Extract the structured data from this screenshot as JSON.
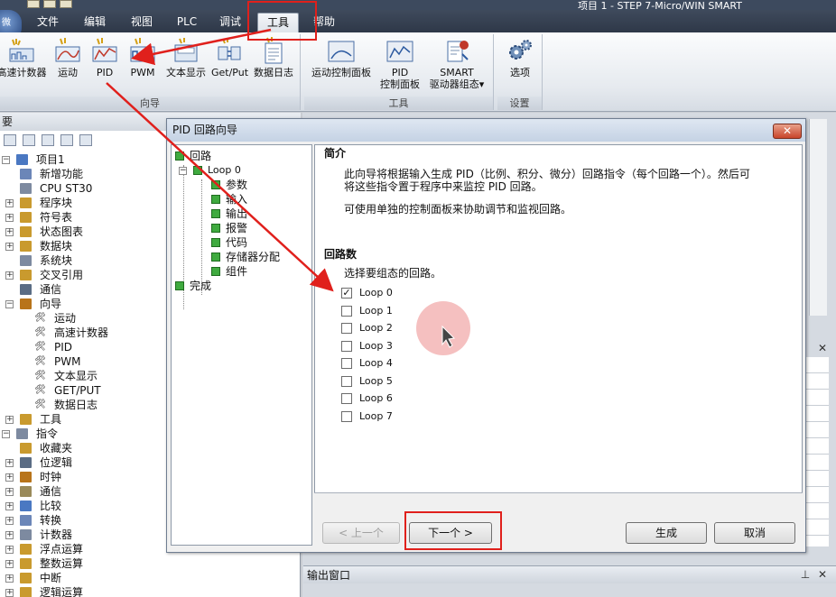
{
  "title": "项目 1 - STEP 7-Micro/WIN SMART",
  "logo_text": "微",
  "menu": [
    "文件",
    "编辑",
    "视图",
    "PLC",
    "调试",
    "工具",
    "帮助"
  ],
  "ribbon": {
    "wizard_group": {
      "label": "向导",
      "buttons": [
        "高速计数器",
        "运动",
        "PID",
        "PWM",
        "文本显示",
        "Get/Put",
        "数据日志"
      ]
    },
    "tools_group": {
      "label": "工具",
      "buttons": [
        {
          "line1": "运动控制面板",
          "line2": ""
        },
        {
          "line1": "PID",
          "line2": "控制面板"
        },
        {
          "line1": "SMART",
          "line2": "驱动器组态▾"
        }
      ]
    },
    "settings_group": {
      "label": "设置",
      "buttons": [
        "选项"
      ]
    }
  },
  "left_pane": {
    "header": "要",
    "tree": [
      {
        "label": "项目1",
        "depth": 0,
        "expander": "⊟"
      },
      {
        "label": "新增功能",
        "depth": 1,
        "expander": ""
      },
      {
        "label": "CPU ST30",
        "depth": 1,
        "expander": ""
      },
      {
        "label": "程序块",
        "depth": 1,
        "expander": "+"
      },
      {
        "label": "符号表",
        "depth": 1,
        "expander": "+"
      },
      {
        "label": "状态图表",
        "depth": 1,
        "expander": "+"
      },
      {
        "label": "数据块",
        "depth": 1,
        "expander": "+"
      },
      {
        "label": "系统块",
        "depth": 1,
        "expander": ""
      },
      {
        "label": "交叉引用",
        "depth": 1,
        "expander": "+"
      },
      {
        "label": "通信",
        "depth": 1,
        "expander": ""
      },
      {
        "label": "向导",
        "depth": 1,
        "expander": "−"
      },
      {
        "label": "运动",
        "depth": 2,
        "expander": ""
      },
      {
        "label": "高速计数器",
        "depth": 2,
        "expander": ""
      },
      {
        "label": "PID",
        "depth": 2,
        "expander": ""
      },
      {
        "label": "PWM",
        "depth": 2,
        "expander": ""
      },
      {
        "label": "文本显示",
        "depth": 2,
        "expander": ""
      },
      {
        "label": "GET/PUT",
        "depth": 2,
        "expander": ""
      },
      {
        "label": "数据日志",
        "depth": 2,
        "expander": ""
      },
      {
        "label": "工具",
        "depth": 1,
        "expander": "+"
      },
      {
        "label": "指令",
        "depth": 0,
        "expander": "−"
      },
      {
        "label": "收藏夹",
        "depth": 1,
        "expander": ""
      },
      {
        "label": "位逻辑",
        "depth": 1,
        "expander": "+"
      },
      {
        "label": "时钟",
        "depth": 1,
        "expander": "+"
      },
      {
        "label": "通信",
        "depth": 1,
        "expander": "+"
      },
      {
        "label": "比较",
        "depth": 1,
        "expander": "+"
      },
      {
        "label": "转换",
        "depth": 1,
        "expander": "+"
      },
      {
        "label": "计数器",
        "depth": 1,
        "expander": "+"
      },
      {
        "label": "浮点运算",
        "depth": 1,
        "expander": "+"
      },
      {
        "label": "整数运算",
        "depth": 1,
        "expander": "+"
      },
      {
        "label": "中断",
        "depth": 1,
        "expander": "+"
      },
      {
        "label": "逻辑运算",
        "depth": 1,
        "expander": "+"
      }
    ]
  },
  "output_window": {
    "title": "输出窗口"
  },
  "dialog": {
    "title": "PID 回路向导",
    "close": "✕",
    "nav_tree": [
      {
        "label": "回路",
        "depth": 0
      },
      {
        "label": "Loop 0",
        "depth": 1
      },
      {
        "label": "参数",
        "depth": 2
      },
      {
        "label": "输入",
        "depth": 2
      },
      {
        "label": "输出",
        "depth": 2
      },
      {
        "label": "报警",
        "depth": 2
      },
      {
        "label": "代码",
        "depth": 2
      },
      {
        "label": "存储器分配",
        "depth": 2
      },
      {
        "label": "组件",
        "depth": 2
      },
      {
        "label": "完成",
        "depth": 0
      }
    ],
    "intro_title": "简介",
    "intro_line1": "此向导将根据输入生成 PID（比例、积分、微分）回路指令（每个回路一个）。然后可",
    "intro_line2": "将这些指令置于程序中来监控 PID 回路。",
    "intro_line3": "可使用单独的控制面板来协助调节和监视回路。",
    "loops_title": "回路数",
    "loops_prompt": "选择要组态的回路。",
    "loops": [
      {
        "label": "Loop 0",
        "checked": true
      },
      {
        "label": "Loop 1",
        "checked": false
      },
      {
        "label": "Loop 2",
        "checked": false
      },
      {
        "label": "Loop 3",
        "checked": false
      },
      {
        "label": "Loop 4",
        "checked": false
      },
      {
        "label": "Loop 5",
        "checked": false
      },
      {
        "label": "Loop 6",
        "checked": false
      },
      {
        "label": "Loop 7",
        "checked": false
      }
    ],
    "buttons": {
      "prev": "< 上一个",
      "next": "下一个 >",
      "generate": "生成",
      "cancel": "取消"
    }
  },
  "colors": {
    "annotation_red": "#e0201c",
    "tree_green": "#3faa3f",
    "menu_bar": "#2e3848"
  }
}
